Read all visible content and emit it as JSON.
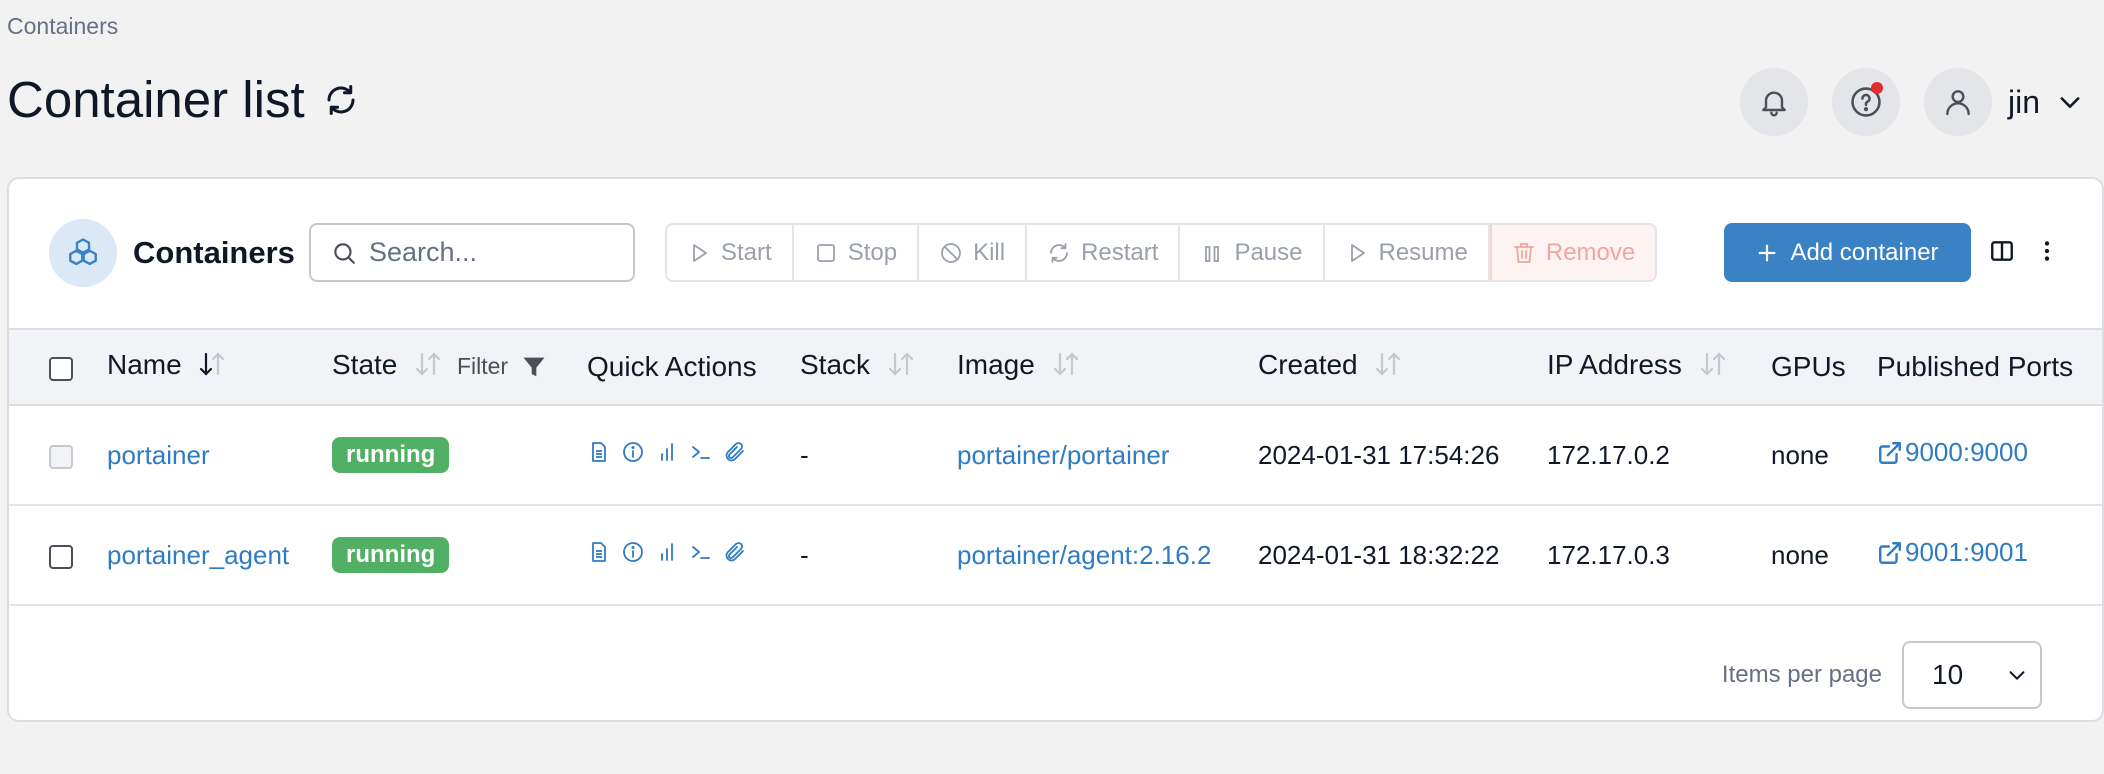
{
  "breadcrumb": "Containers",
  "page_title": "Container list",
  "user": {
    "name": "jin"
  },
  "card": {
    "title": "Containers",
    "search_placeholder": "Search...",
    "actions": {
      "start": "Start",
      "stop": "Stop",
      "kill": "Kill",
      "restart": "Restart",
      "pause": "Pause",
      "resume": "Resume",
      "remove": "Remove"
    },
    "add_label": "Add container"
  },
  "table": {
    "headers": {
      "name": "Name",
      "state": "State",
      "filter": "Filter",
      "quick_actions": "Quick Actions",
      "stack": "Stack",
      "image": "Image",
      "created": "Created",
      "ip": "IP Address",
      "gpus": "GPUs",
      "ports": "Published Ports"
    },
    "rows": [
      {
        "name": "portainer",
        "state": "running",
        "stack": "-",
        "image": "portainer/portainer",
        "created": "2024-01-31 17:54:26",
        "ip": "172.17.0.2",
        "gpus": "none",
        "ports": "9000:9000"
      },
      {
        "name": "portainer_agent",
        "state": "running",
        "stack": "-",
        "image": "portainer/agent:2.16.2",
        "created": "2024-01-31 18:32:22",
        "ip": "172.17.0.3",
        "gpus": "none",
        "ports": "9001:9001"
      }
    ]
  },
  "pagination": {
    "label": "Items per page",
    "value": "10"
  },
  "colors": {
    "accent": "#3a82c4",
    "link": "#2f7bc4",
    "running": "#52b064",
    "notification_dot": "#e02d2d"
  }
}
